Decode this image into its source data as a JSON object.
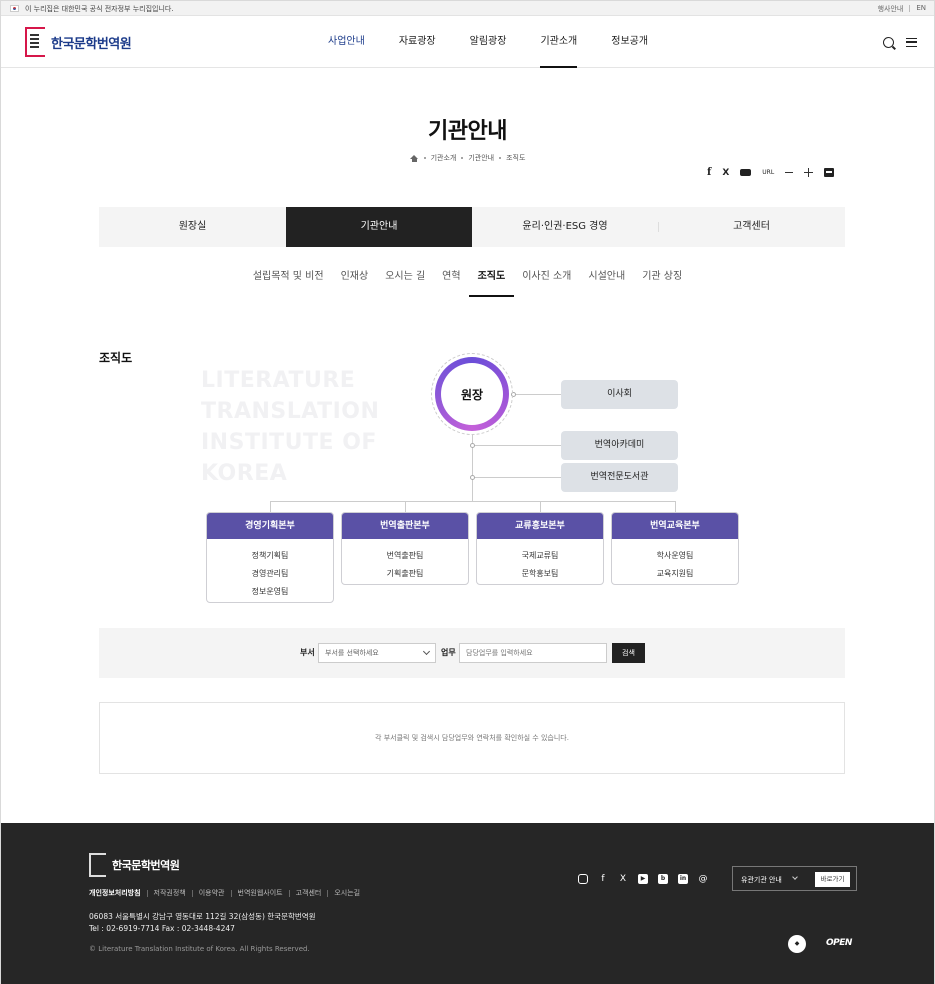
{
  "gov_banner": {
    "message": "이 누리집은 대한민국 공식 전자정부 누리집입니다.",
    "links": [
      "행사안내",
      "EN"
    ]
  },
  "header": {
    "logo_text": "한국문학번역원",
    "nav": [
      "사업안내",
      "자료광장",
      "알림광장",
      "기관소개",
      "정보공개"
    ]
  },
  "page": {
    "title": "기관안내",
    "breadcrumb": [
      "기관소개",
      "기관안내",
      "조직도"
    ],
    "share": {
      "url_label": "URL"
    }
  },
  "tabs": [
    "원장실",
    "기관안내",
    "윤리·인권·ESG 경영",
    "고객센터"
  ],
  "subtabs": [
    "설립목적 및 비전",
    "인재상",
    "오시는 길",
    "연혁",
    "조직도",
    "이사진 소개",
    "시설안내",
    "기관 상징"
  ],
  "section_title": "조직도",
  "watermark": [
    "LITERATURE",
    "TRANSLATION",
    "INSTITUTE OF",
    "KOREA"
  ],
  "org": {
    "head": "원장",
    "board": "이사회",
    "side_units": [
      "번역아카데미",
      "번역전문도서관"
    ],
    "departments": [
      {
        "name": "경영기획본부",
        "teams": [
          "정책기획팀",
          "경영관리팀",
          "정보운영팀"
        ]
      },
      {
        "name": "번역출판본부",
        "teams": [
          "번역출판팀",
          "기획출판팀"
        ]
      },
      {
        "name": "교류홍보본부",
        "teams": [
          "국제교류팀",
          "문학홍보팀"
        ]
      },
      {
        "name": "번역교육본부",
        "teams": [
          "학사운영팀",
          "교육지원팀"
        ]
      }
    ]
  },
  "search": {
    "dept_label": "부서",
    "dept_placeholder": "부서를 선택하세요",
    "task_label": "업무",
    "task_placeholder": "담당업무를 입력하세요",
    "button": "검색"
  },
  "result_text": "각 부서클릭 및 검색시 담당업무와 연락처를 확인하실 수 있습니다.",
  "footer": {
    "logo_text": "한국문학번역원",
    "links": [
      "개인정보처리방침",
      "저작권정책",
      "이용약관",
      "번역원웹사이트",
      "고객센터",
      "오시는길"
    ],
    "address": "06083 서울특별시 강남구 영동대로 112길 32(삼성동) 한국문학번역원",
    "phone": "Tel : 02-6919-7714   Fax : 02-3448-4247",
    "copyright": "© Literature Translation Institute of Korea. All Rights Reserved.",
    "family_site": "유관기관 안내",
    "go_button": "바로가기",
    "social_icons": [
      "instagram-icon",
      "facebook-icon",
      "x-icon",
      "youtube-icon",
      "blog-icon",
      "linkedin-icon",
      "threads-icon"
    ]
  }
}
